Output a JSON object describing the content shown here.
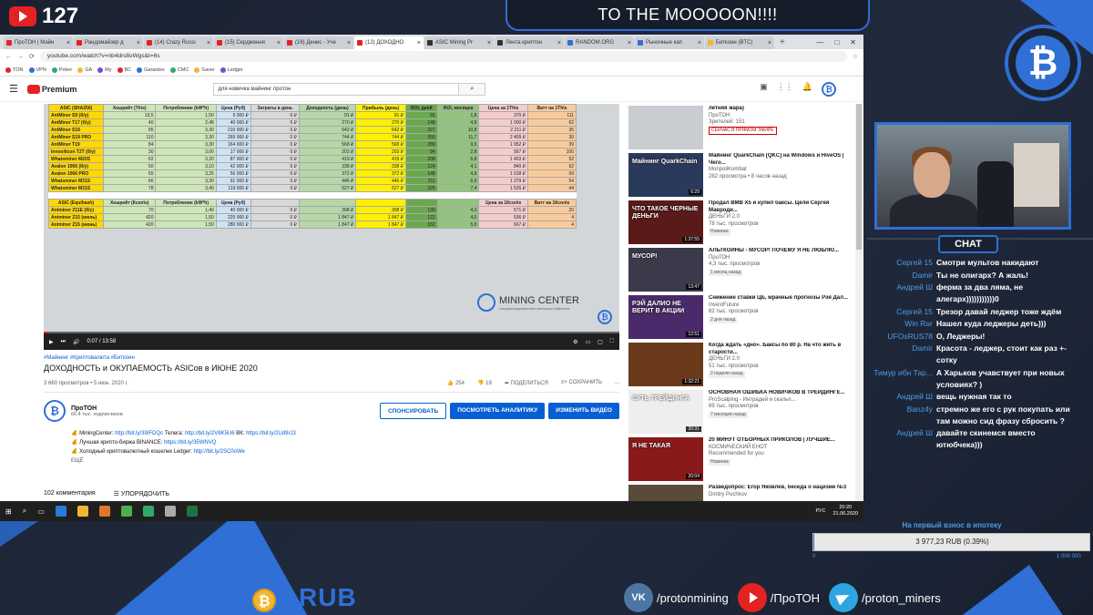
{
  "overlay": {
    "yt_subscribers": "127",
    "title": "TO THE MOOOOON!!!!",
    "btc_symbol": "₿",
    "chat_label": "CHAT",
    "currency": "RUB",
    "goal_label": "На первый взнос в ипотеку",
    "goal_text": "3 977,23 RUB (0.39%)",
    "goal_percent": 0.39,
    "goal_min": "0",
    "goal_max": "1 000 000",
    "socials": [
      {
        "name": "vk",
        "glyph": "VK",
        "label": "/protonmining"
      },
      {
        "name": "youtube",
        "glyph": "",
        "label": "/ПроТОН"
      },
      {
        "name": "telegram",
        "glyph": "",
        "label": "/proton_miners"
      }
    ]
  },
  "colors": {
    "accent": "#2f6fd6",
    "yt_red": "#e42222",
    "link": "#065fd4"
  },
  "browser": {
    "tabs": [
      {
        "label": "ПроТОН | Майн",
        "color": "#e42222"
      },
      {
        "label": "Рандомайзер д",
        "color": "#e42222"
      },
      {
        "label": "(14) Crazy Russi",
        "color": "#e42222"
      },
      {
        "label": "(15) Сердження",
        "color": "#e42222"
      },
      {
        "label": "(16) Денис - Уче",
        "color": "#e42222"
      },
      {
        "label": "(12) ДОХОДНО",
        "color": "#e42222",
        "active": true
      },
      {
        "label": "ASIC Mining Pr",
        "color": "#333"
      },
      {
        "label": "Лента криптон",
        "color": "#333"
      },
      {
        "label": "RANDOM.ORG",
        "color": "#2f6fd6"
      },
      {
        "label": "Рыночные кап",
        "color": "#2f6fd6"
      },
      {
        "label": "Биткоин (BTC)",
        "color": "#f2b632"
      }
    ],
    "tab_close": "×",
    "tab_plus": "+",
    "window_controls": [
      "—",
      "□",
      "✕"
    ],
    "url": "youtube.com/watch?v=nb4drs8oWgs&t=6s",
    "nav": [
      "←",
      "→",
      "⟳"
    ],
    "bookmarks": [
      "TON",
      "VPN",
      "Poker",
      "GA",
      "My",
      "BC",
      "Garantex",
      "CMC",
      "Saver",
      "Ledger"
    ],
    "yt_brand": "Premium",
    "search_value": "для новичка майнинг протон",
    "search_icon": "⌕"
  },
  "sheet": {
    "headers1": [
      "ASIC (SHA256)",
      "Хешрейт (Th\\s)",
      "Потребление (kW*h)",
      "Цена (Руб)",
      "Затраты в день",
      "Доходность (день)",
      "Прибыль (день)",
      "ROI, дней",
      "ROI, месяцев",
      "Цена за 1Th\\s",
      "Ватт на 1Th\\s"
    ],
    "rows1": [
      [
        "AntMiner S9 (б/у)",
        "13,5",
        "1,50",
        "5 000 ₽",
        "0 ₽",
        "91 ₽",
        "91 ₽",
        "55",
        "1,8",
        "370 ₽",
        "111"
      ],
      [
        "AntMiner T17 (б/у)",
        "40",
        "2,48",
        "40 000 ₽",
        "0 ₽",
        "270 ₽",
        "270 ₽",
        "148",
        "4,9",
        "1 000 ₽",
        "62"
      ],
      [
        "AntMiner S19",
        "95",
        "3,30",
        "210 000 ₽",
        "0 ₽",
        "642 ₽",
        "642 ₽",
        "327",
        "10,8",
        "2 211 ₽",
        "35"
      ],
      [
        "AntMiner S19 PRO",
        "110",
        "3,30",
        "265 000 ₽",
        "0 ₽",
        "744 ₽",
        "744 ₽",
        "356",
        "11,7",
        "2 409 ₽",
        "30"
      ],
      [
        "AntMiner T19",
        "84",
        "3,30",
        "164 000 ₽",
        "0 ₽",
        "568 ₽",
        "568 ₽",
        "289",
        "9,5",
        "1 952 ₽",
        "39"
      ],
      [
        "Innosilicon T2T (б/у)",
        "30",
        "3,00",
        "17 000 ₽",
        "0 ₽",
        "203 ₽",
        "203 ₽",
        "84",
        "2,8",
        "567 ₽",
        "100"
      ],
      [
        "Whatsminer M20S",
        "62",
        "3,20",
        "87 000 ₽",
        "0 ₽",
        "419 ₽",
        "419 ₽",
        "208",
        "6,8",
        "1 403 ₽",
        "52"
      ],
      [
        "Avalon 1066 (б/у)",
        "50",
        "3,10",
        "42 000 ₽",
        "0 ₽",
        "338 ₽",
        "338 ₽",
        "124",
        "4,1",
        "840 ₽",
        "62"
      ],
      [
        "Avalon 1066 PRO",
        "55",
        "3,25",
        "56 000 ₽",
        "0 ₽",
        "372 ₽",
        "372 ₽",
        "148",
        "4,9",
        "1 018 ₽",
        "59"
      ],
      [
        "Whatsminer M31S",
        "66",
        "3,30",
        "91 000 ₽",
        "0 ₽",
        "446 ₽",
        "446 ₽",
        "211",
        "6,9",
        "1 379 ₽",
        "54"
      ],
      [
        "Whatsminer M31S",
        "78",
        "3,40",
        "119 000 ₽",
        "0 ₽",
        "527 ₽",
        "527 ₽",
        "226",
        "7,4",
        "1 526 ₽",
        "44"
      ]
    ],
    "headers2": [
      "ASIC (Equihash)",
      "Хешрейт (Ксол\\s)",
      "Потребление (kW*h)",
      "Цена (Руб)",
      "",
      "",
      "",
      "",
      "",
      "Цена за 1Ксол\\s",
      "Ватт на 1Ксол\\s"
    ],
    "rows2": [
      [
        "Antminer Z11E (б/у)",
        "70",
        "1,40",
        "40 000 ₽",
        "0 ₽",
        "308 ₽",
        "308 ₽",
        "130",
        "4,3",
        "571 ₽",
        "20"
      ],
      [
        "Antminer Z15 (июль)",
        "420",
        "1,50",
        "225 000 ₽",
        "0 ₽",
        "1 847 ₽",
        "1 847 ₽",
        "122",
        "4,0",
        "536 ₽",
        "4"
      ],
      [
        "Antminer Z15 (июнь)",
        "420",
        "1,50",
        "280 000 ₽",
        "0 ₽",
        "1 847 ₽",
        "1 847 ₽",
        "152",
        "5,0",
        "667 ₽",
        "4"
      ]
    ],
    "logo_title": "MINING CENTER",
    "logo_sub": "специализированные магазины майнинга"
  },
  "player": {
    "time": "0:07 / 13:58",
    "progress": 0.008,
    "icons": [
      "▶",
      "⏭",
      "🔊"
    ],
    "right_icons": [
      "⚙",
      "▭",
      "▢",
      "⛶"
    ]
  },
  "video": {
    "tags": "#Майнинг #Криптовалюта #Биткоин",
    "title": "ДОХОДНОСТЬ и ОКУПАЕМОСТЬ ASICов в ИЮНЕ 2020",
    "views": "3 660 просмотров • 5 июн. 2020 г.",
    "likes": "254",
    "dislikes": "19",
    "share": "ПОДЕЛИТЬСЯ",
    "save": "СОХРАНИТЬ",
    "more": "...",
    "channel": "ПроТОН",
    "subs": "66,4 тыс. подписчиков",
    "btn_sponsor": "СПОНСИРОВАТЬ",
    "btn_analytics": "ПОСМОТРЕТЬ АНАЛИТИКУ",
    "btn_edit": "ИЗМЕНИТЬ ВИДЕО",
    "desc": [
      {
        "pre": "💰 MiningCenter: ",
        "link": "http://bit.ly/39IFDQc",
        "post": " Телега: ",
        "link2": "http://bit.ly/2V8K5U6",
        "post2": " ВК: ",
        "link3": "https://bit.ly/2Ud9rJ3"
      },
      {
        "pre": "💰 Лучшая крипто-биржа BINANCE: ",
        "link": "https://bit.ly/35WNVQ",
        "post": "",
        "link2": "",
        "post2": "",
        "link3": ""
      },
      {
        "pre": "💰 Холодный криптовалютный кошелек Ledger: ",
        "link": "http://bit.ly/2SC0oWe",
        "post": "",
        "link2": "",
        "post2": "",
        "link3": ""
      }
    ],
    "desc_more": "ЕЩЁ",
    "comments": "102 комментария",
    "sort": "УПОРЯДОЧИТЬ"
  },
  "sidebar": [
    {
      "title": "летняя жара)",
      "channel": "ПроТОН",
      "meta": "Зрителей: 151",
      "badge": "СЕЙЧАС В ПРЯМОМ ЭФИРЕ",
      "live": true,
      "dur": "",
      "cap": "",
      "bg": "#c9ccd0"
    },
    {
      "title": "Майнинг QuarkChain [QKC] на Windows и HiveOS | Чего...",
      "channel": "MonpoliKombat",
      "meta": "282 просмотра • 8 часов назад",
      "badge": "",
      "live": false,
      "dur": "6:29",
      "cap": "Майнинг QuarkChain",
      "bg": "#2a3a5a"
    },
    {
      "title": "Продал BMB X5 и купил баксы. Цели Сергея Мавроди...",
      "channel": "ДЕНЬГИ 2.0",
      "meta": "78 тыс. просмотров",
      "badge": "Новинка",
      "live": false,
      "dur": "1:37:55",
      "cap": "ЧТО ТАКОЕ ЧЕРНЫЕ ДЕНЬГИ",
      "bg": "#5a1a1a"
    },
    {
      "title": "АЛЬТКОИНЫ - МУСОР! ПОЧЕМУ Я НЕ ЛЮБЛЮ...",
      "channel": "ПроТОН",
      "meta": "4,3 тыс. просмотров",
      "badge": "1 месяц назад",
      "live": false,
      "dur": "13:47",
      "cap": "МУСОР!",
      "bg": "#3a3a4a"
    },
    {
      "title": "Снижение ставки ЦБ, мрачные прогнозы Рэя Дал...",
      "channel": "InvestFuture",
      "meta": "82 тыс. просмотров",
      "badge": "2 дня назад",
      "live": false,
      "dur": "12:51",
      "cap": "РЭЙ ДАЛИО НЕ ВЕРИТ В АКЦИИ",
      "bg": "#4a2a6a"
    },
    {
      "title": "Когда ждать «дно». Баксы по 80 р. На что жить в старости...",
      "channel": "ДЕНЬГИ 2.0",
      "meta": "51 тыс. просмотров",
      "badge": "2 недели назад",
      "live": false,
      "dur": "1:32:21",
      "cap": "",
      "bg": "#6a3a1a"
    },
    {
      "title": "ОСНОВНАЯ ОШИБКА НОВИЧКОВ В ТРЕЙДИНГЕ...",
      "channel": "ProScalping - Интрадей и скальп...",
      "meta": "69 тыс. просмотров",
      "badge": "7 месяцев назад",
      "live": false,
      "dur": "20:31",
      "cap": "СУТЬ ТРЕЙДИНГА",
      "bg": "#eeeeee"
    },
    {
      "title": "20 МИНУТ ОТБОРНЫХ ПРИКОЛОВ | ЛУЧШИЕ...",
      "channel": "КОСМИЧЕСКИЙ ЕНОТ",
      "meta": "Recommended for you",
      "badge": "Новинка",
      "live": false,
      "dur": "20:04",
      "cap": "Я НЕ ТАКАЯ",
      "bg": "#8a1a1a"
    },
    {
      "title": "Разведопрос: Егор Яковлев, беседа о нацизме №3",
      "channel": "Dmitry Puchkov",
      "meta": "",
      "badge": "",
      "live": false,
      "dur": "",
      "cap": "",
      "bg": "#5a4a3a"
    }
  ],
  "taskbar": {
    "lang": "РУС",
    "time": "20:20",
    "date": "21.06.2020"
  },
  "chat": [
    {
      "user": "Сергей 15",
      "text": "Смотри мультов накидают"
    },
    {
      "user": "Damir",
      "text": "Ты не олигарх? А жаль!"
    },
    {
      "user": "Андрей Ш",
      "text": "ферма за два ляма, не алегарх)))))))))))0"
    },
    {
      "user": "Сергей 15",
      "text": "Трезор давай леджер тоже ждём"
    },
    {
      "user": "Win Rar",
      "text": "Нашел куда леджеры деть)))"
    },
    {
      "user": "UFOsRUS78",
      "text": "О, Леджеры!"
    },
    {
      "user": "Damir",
      "text": "Красота - леджер, стоит как раз +- сотку"
    },
    {
      "user": "Тимур ибн Тар...",
      "text": "А Харьков учавствует при новых условиях? )"
    },
    {
      "user": "Андрей Ш",
      "text": "вещь нужная так то"
    },
    {
      "user": "Banz4y",
      "text": "стремно же его с рук покупать или там можно сид фразу сбросить ?"
    },
    {
      "user": "Андрей Ш",
      "text": "давайте скинемся вместо ютюбчека)))"
    }
  ]
}
